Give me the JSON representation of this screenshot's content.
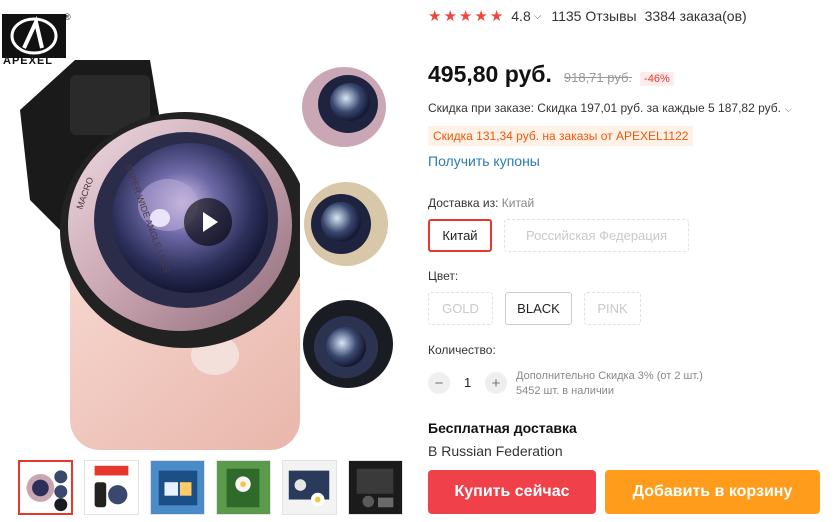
{
  "brand": {
    "logo_text": "APEXEL",
    "reg": "®"
  },
  "product": {
    "rating": "4.8",
    "rating_stars": 5,
    "reviews": "1135 Отзывы",
    "orders": "3384 заказа(ов)",
    "price": "495,80 руб.",
    "old_price": "918,71 руб.",
    "discount": "-46%",
    "store_discount": "Скидка при заказе: Скидка 197,01 руб. за каждые 5 187,82 руб.",
    "coupon_tag": "Скидка 131,34 руб. на заказы от APEXEL1122",
    "coupon_link": "Получить купоны"
  },
  "shipping_from": {
    "label": "Доставка из:",
    "value": "Китай",
    "options": [
      "Китай",
      "Российская Федерация"
    ]
  },
  "color": {
    "label": "Цвет:",
    "options": [
      "GOLD",
      "BLACK",
      "PINK"
    ]
  },
  "quantity": {
    "label": "Количество:",
    "value": "1",
    "minus": "−",
    "plus": "+",
    "note_line1": "Дополнительно Скидка 3% (от 2 шт.)",
    "note_line2": "5452 шт. в наличии"
  },
  "delivery": {
    "title": "Бесплатная доставка",
    "subtitle": "В Russian Federation"
  },
  "actions": {
    "buy_now": "Купить сейчас",
    "add_to_cart": "Добавить в корзину"
  },
  "icons": {
    "star": "star-icon",
    "play": "play-icon",
    "caret": "chevron-down-icon"
  },
  "colors": {
    "accent_red": "#e6362d",
    "buy_button": "#f0404a",
    "cart_button": "#ff9c1b",
    "link_blue": "#2a7bb8",
    "coupon_orange": "#e65a0f"
  }
}
